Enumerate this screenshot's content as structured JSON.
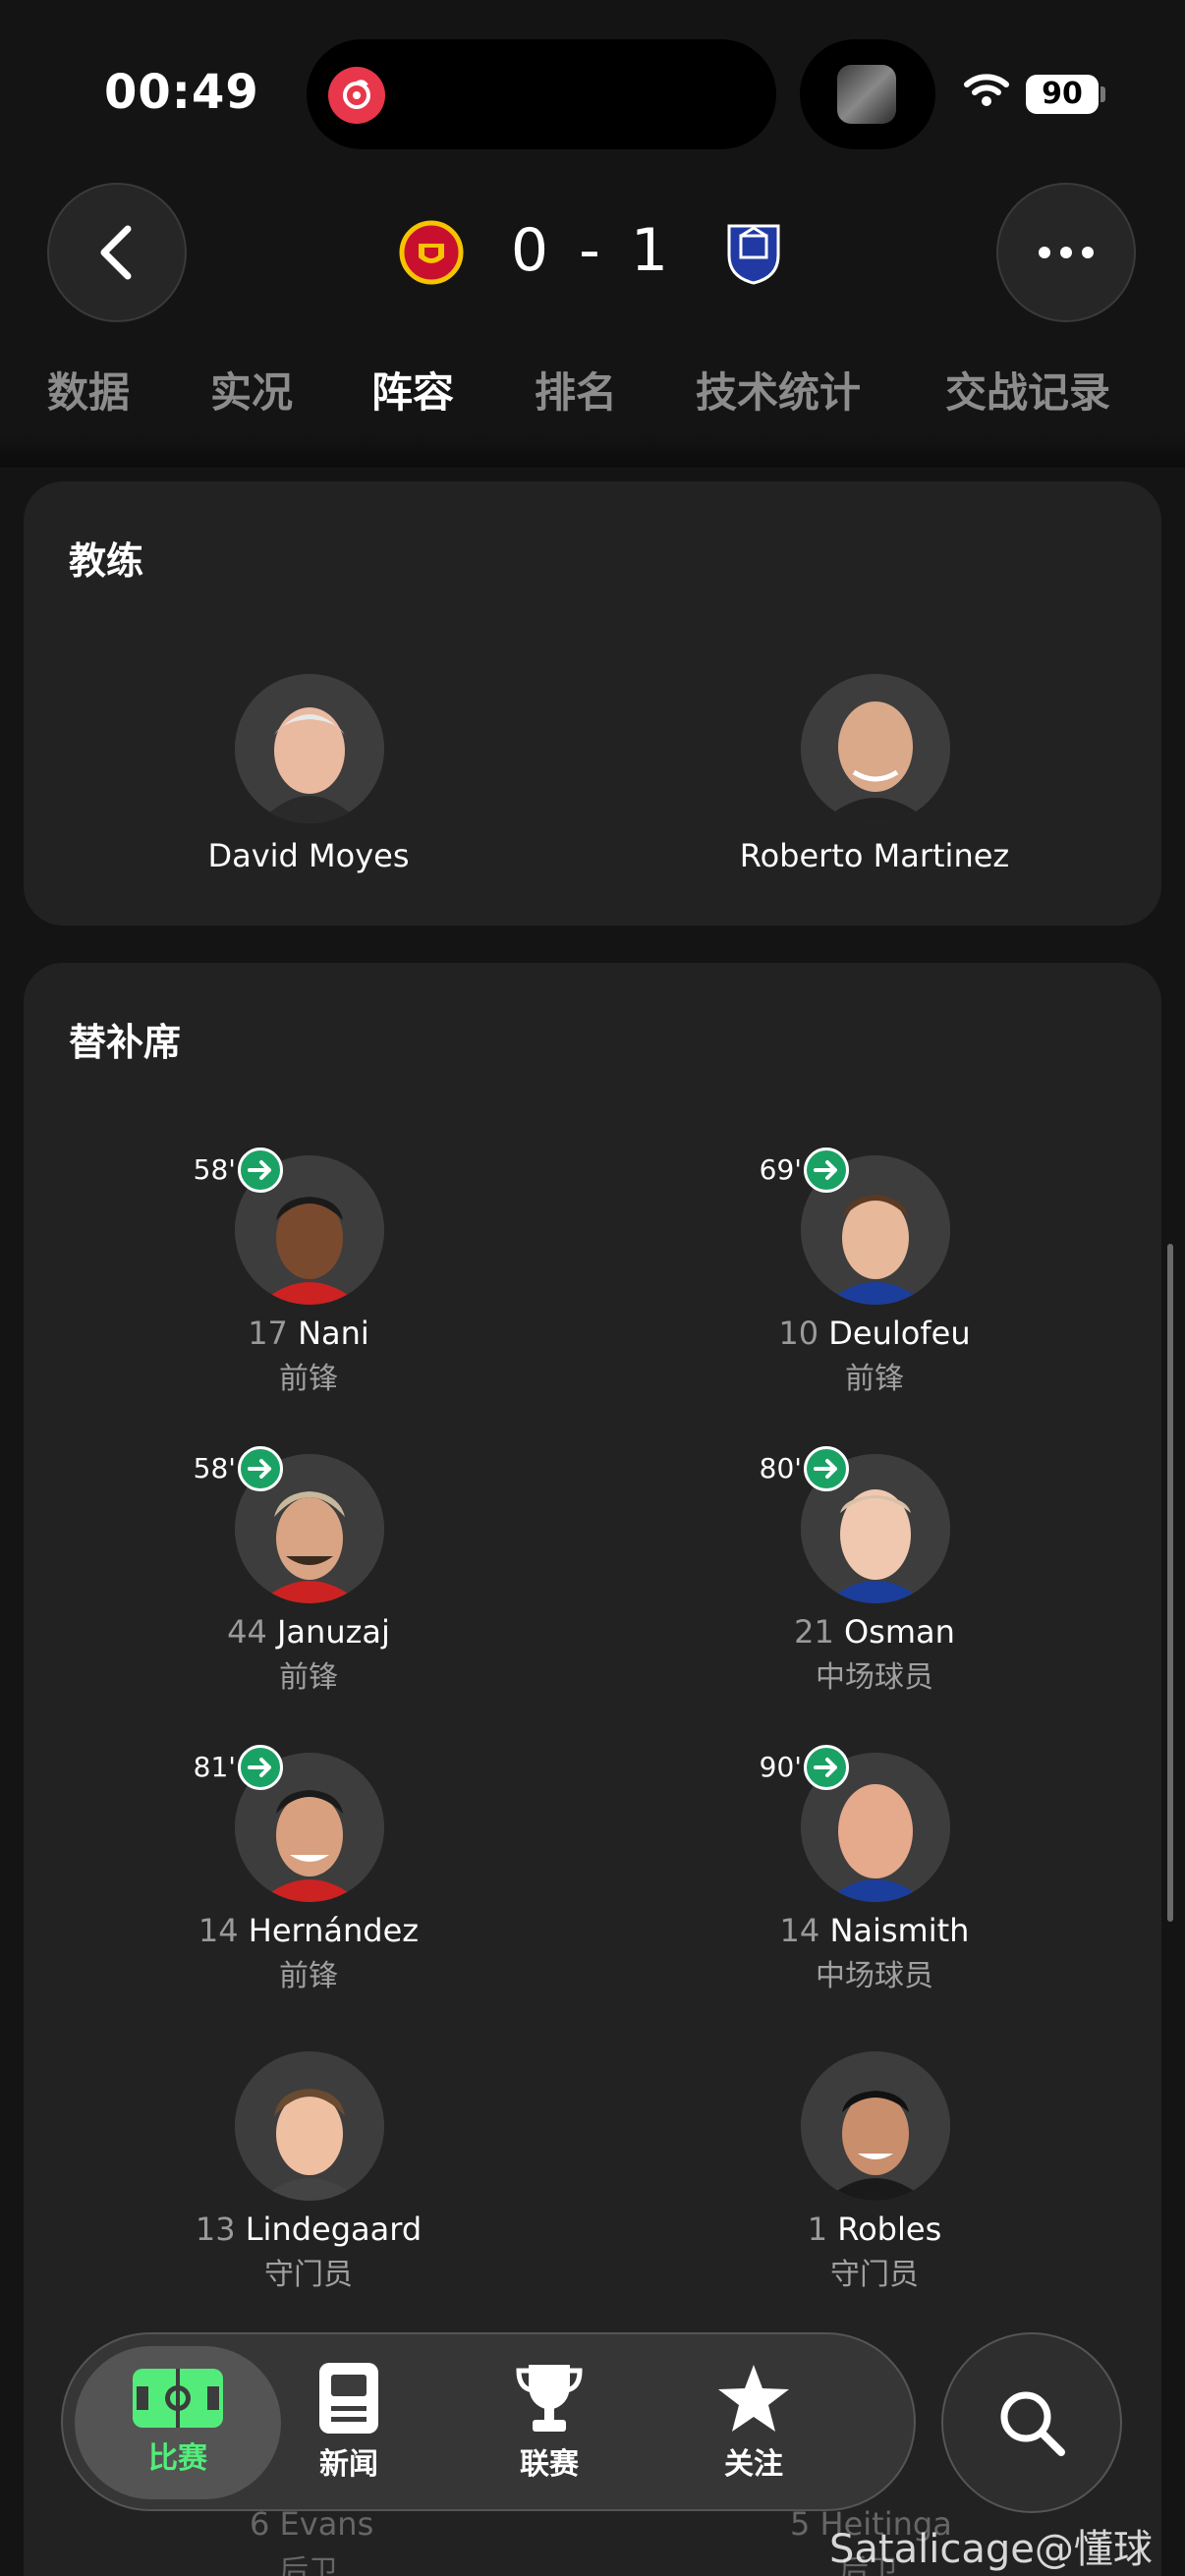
{
  "status_bar": {
    "time": "00:49",
    "battery": "90"
  },
  "match": {
    "home_score": "0",
    "separator": "-",
    "away_score": "1",
    "home_team_icon": "manchester-united-crest",
    "away_team_icon": "everton-crest"
  },
  "tabs": [
    {
      "label": "数据",
      "active": false
    },
    {
      "label": "实况",
      "active": false
    },
    {
      "label": "阵容",
      "active": true
    },
    {
      "label": "排名",
      "active": false
    },
    {
      "label": "技术统计",
      "active": false
    },
    {
      "label": "交战记录",
      "active": false
    }
  ],
  "coaches": {
    "title": "教练",
    "home": {
      "name": "David Moyes"
    },
    "away": {
      "name": "Roberto Martinez"
    }
  },
  "bench": {
    "title": "替补席",
    "home": [
      {
        "number": "17",
        "name": "Nani",
        "position": "前锋",
        "sub_minute": "58'"
      },
      {
        "number": "44",
        "name": "Januzaj",
        "position": "前锋",
        "sub_minute": "58'"
      },
      {
        "number": "14",
        "name": "Hernández",
        "position": "前锋",
        "sub_minute": "81'"
      },
      {
        "number": "13",
        "name": "Lindegaard",
        "position": "守门员",
        "sub_minute": ""
      }
    ],
    "away": [
      {
        "number": "10",
        "name": "Deulofeu",
        "position": "前锋",
        "sub_minute": "69'"
      },
      {
        "number": "21",
        "name": "Osman",
        "position": "中场球员",
        "sub_minute": "80'"
      },
      {
        "number": "14",
        "name": "Naismith",
        "position": "中场球员",
        "sub_minute": "90'"
      },
      {
        "number": "1",
        "name": "Robles",
        "position": "守门员",
        "sub_minute": ""
      }
    ],
    "peek": [
      {
        "number": "6",
        "name": "Evans",
        "position": "后卫"
      },
      {
        "number": "5",
        "name": "Heitinga",
        "position": "后卫"
      }
    ]
  },
  "bottom_nav": [
    {
      "label": "比赛",
      "icon": "pitch-icon",
      "active": true
    },
    {
      "label": "新闻",
      "icon": "news-icon",
      "active": false
    },
    {
      "label": "联赛",
      "icon": "trophy-icon",
      "active": false
    },
    {
      "label": "关注",
      "icon": "star-icon",
      "active": false
    }
  ],
  "watermark": "Satalicage@懂球帝",
  "colors": {
    "background": "#141414",
    "card": "#222222",
    "accent_green": "#53ec7a",
    "sub_icon": "#1aa264"
  }
}
